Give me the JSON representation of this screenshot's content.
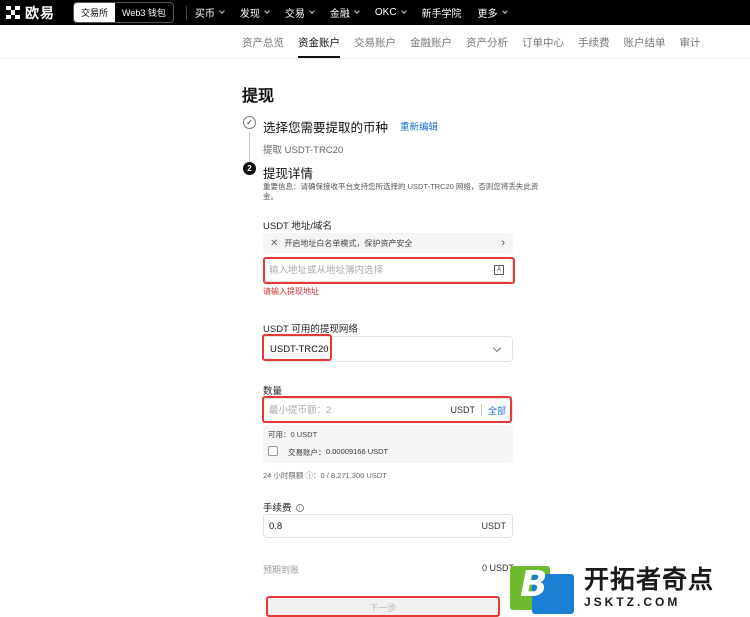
{
  "topbar": {
    "brand": "欧易",
    "mode_exchange": "交易所",
    "mode_web3": "Web3 钱包",
    "nav": [
      "买币",
      "发现",
      "交易",
      "金融",
      "OKC",
      "新手学院",
      "更多"
    ]
  },
  "subnav": {
    "items": [
      "资产总览",
      "资金账户",
      "交易账户",
      "金融账户",
      "资产分析",
      "订单中心",
      "手续费",
      "账户结单",
      "审计"
    ],
    "active_index": 1
  },
  "page": {
    "title": "提现",
    "step1": {
      "number": "✓",
      "title": "选择您需要提取的币种",
      "reedit": "重新编辑",
      "summary": "提取 USDT-TRC20"
    },
    "step2": {
      "number": "2",
      "title": "提现详情",
      "notice": "重要信息：请确保接收平台支持您所选择的 USDT-TRC20 网络，否则您将丢失此资金。"
    }
  },
  "address": {
    "label": "USDT 地址/域名",
    "whitelist_text": "开启地址白名单模式，保护资产安全",
    "placeholder": "输入地址或从地址簿内选择",
    "error": "请输入提现地址"
  },
  "network": {
    "label": "USDT 可用的提现网络",
    "value": "USDT-TRC20"
  },
  "amount": {
    "label": "数量",
    "placeholder": "最小提币额：2",
    "unit": "USDT",
    "all": "全部",
    "available": "可用：0 USDT",
    "account_label": "交易账户：",
    "account_value": "0.00009166 USDT",
    "limit": "24 小时限额 ⓘ：0 / 8,271,300 USDT"
  },
  "fee": {
    "label": "手续费",
    "value": "0.8",
    "unit": "USDT"
  },
  "expected": {
    "label": "预期到账",
    "value": "0 USDT"
  },
  "next_button": "下一步",
  "watermark": {
    "letter": "B",
    "cn": "开拓者奇点",
    "en": "JSKTZ.COM"
  }
}
